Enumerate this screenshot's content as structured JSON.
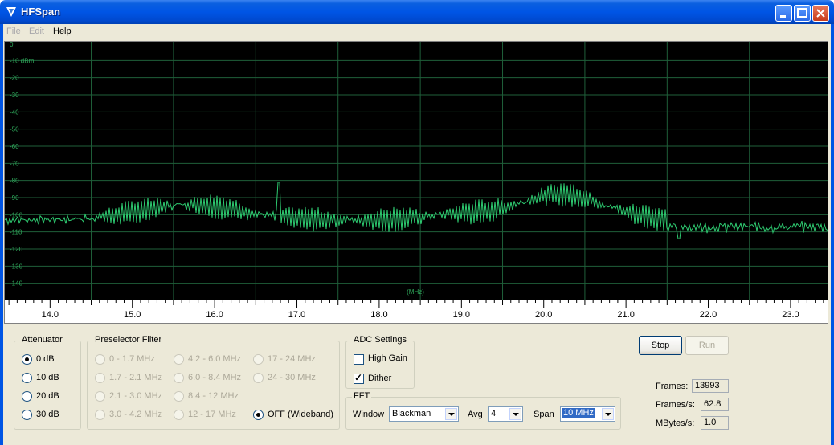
{
  "window": {
    "title": "HFSpan"
  },
  "menu": {
    "items": [
      {
        "label": "File",
        "enabled": false
      },
      {
        "label": "Edit",
        "enabled": false
      },
      {
        "label": "Help",
        "enabled": true
      }
    ]
  },
  "spectrum": {
    "y_labels": [
      "0",
      "-10 dBm",
      "-20",
      "-30",
      "-40",
      "-50",
      "-60",
      "-70",
      "-80",
      "-90",
      "-100",
      "-110",
      "-120",
      "-130",
      "-140"
    ],
    "x_unit": "(MHz)",
    "x_ticks": [
      "14.0",
      "15.0",
      "16.0",
      "17.0",
      "18.0",
      "19.0",
      "20.0",
      "21.0",
      "22.0",
      "23.0"
    ],
    "x_range": [
      13.45,
      23.45
    ],
    "y_range": [
      0,
      -150
    ],
    "trace_color": "#2ecc71",
    "grid_color": "#1f5f3a"
  },
  "attenuator": {
    "label": "Attenuator",
    "options": [
      "0 dB",
      "10 dB",
      "20 dB",
      "30 dB"
    ],
    "selected": "0 dB"
  },
  "preselector": {
    "label": "Preselector Filter",
    "options": [
      "0 - 1.7 MHz",
      "1.7 - 2.1 MHz",
      "2.1 - 3.0 MHz",
      "3.0 - 4.2 MHz",
      "4.2 - 6.0 MHz",
      "6.0 - 8.4 MHz",
      "8.4 - 12 MHz",
      "12 - 17 MHz",
      "17 - 24 MHz",
      "24 - 30 MHz",
      "OFF (Wideband)"
    ],
    "selected": "OFF (Wideband)"
  },
  "adc": {
    "label": "ADC Settings",
    "high_gain": {
      "label": "High Gain",
      "checked": false
    },
    "dither": {
      "label": "Dither",
      "checked": true
    }
  },
  "fft": {
    "label": "FFT",
    "window_label": "Window",
    "window_value": "Blackman",
    "avg_label": "Avg",
    "avg_value": "4",
    "span_label": "Span",
    "span_value": "10 MHz"
  },
  "controls": {
    "stop_label": "Stop",
    "run_label": "Run"
  },
  "status": {
    "frames_label": "Frames:",
    "frames_value": "13993",
    "fps_label": "Frames/s:",
    "fps_value": "62.8",
    "mbps_label": "MBytes/s:",
    "mbps_value": "1.0"
  }
}
